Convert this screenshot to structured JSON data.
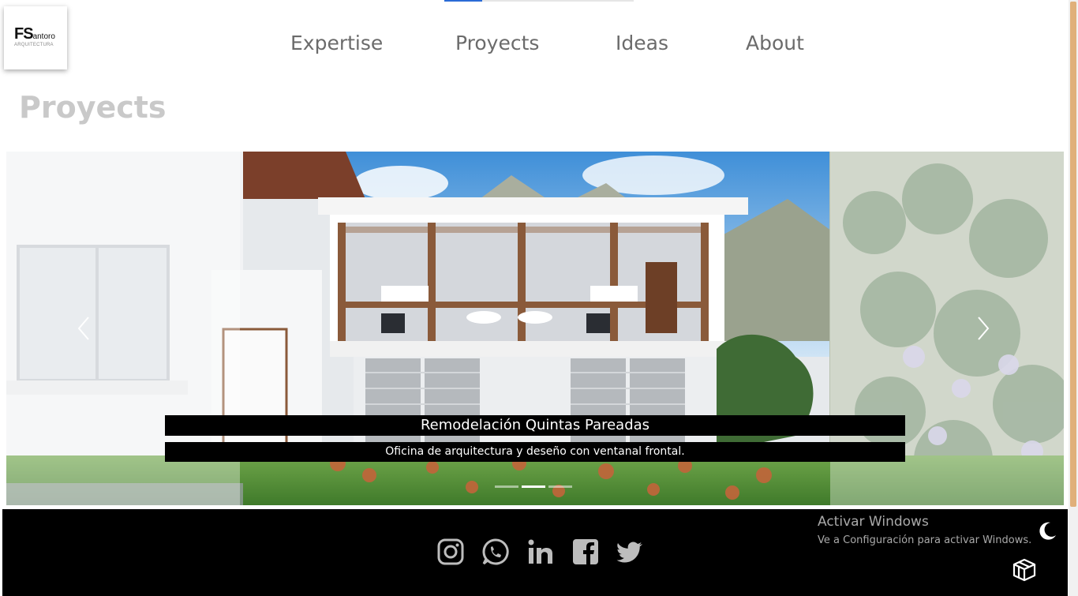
{
  "logo": {
    "mark": "FS",
    "mark_rest": "antoro",
    "subtitle": "ARQUITECTURA"
  },
  "top_progress": {
    "fraction": 0.2
  },
  "nav": {
    "items": [
      {
        "label": "Expertise"
      },
      {
        "label": "Proyects"
      },
      {
        "label": "Ideas"
      },
      {
        "label": "About"
      }
    ]
  },
  "page": {
    "title": "Proyects"
  },
  "carousel": {
    "caption_title": "Remodelación Quintas Pareadas",
    "caption_text": "Oficina de arquitectura y deseño con ventanal frontal.",
    "slide_count": 3,
    "active_index": 1,
    "prev_icon": "chevron-left-icon",
    "next_icon": "chevron-right-icon"
  },
  "footer": {
    "social": [
      "instagram-icon",
      "whatsapp-icon",
      "linkedin-icon",
      "facebook-icon",
      "twitter-icon"
    ],
    "watermark_title": "Activar Windows",
    "watermark_sub": "Ve a Configuración para activar Windows.",
    "theme_icon": "moon-icon",
    "extra_icon": "cube-icon"
  },
  "colors": {
    "accent": "#2a6bd6",
    "nav_text": "#6b6b6b",
    "title_text": "#c9c9c9",
    "scroll_thumb": "#e0b07a",
    "footer_bg": "#000000"
  }
}
